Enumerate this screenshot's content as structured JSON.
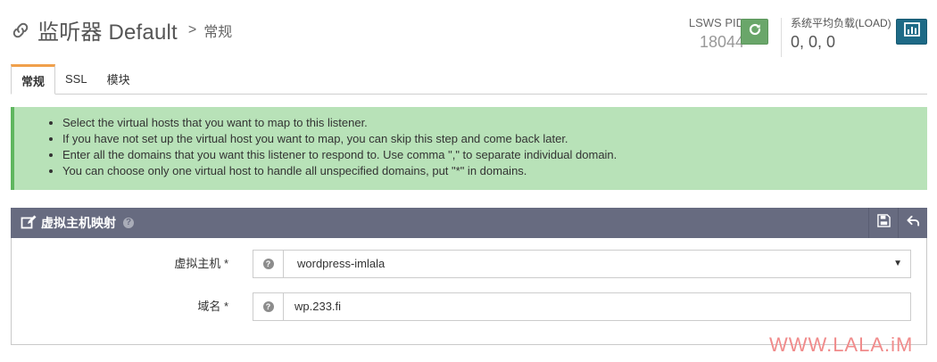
{
  "header": {
    "title": "监听器 Default",
    "breadcrumb_separator": ">",
    "breadcrumb_current": "常规",
    "link_icon": "link-icon"
  },
  "status": {
    "pid_label": "LSWS PID",
    "pid_value": "18044",
    "restart_icon": "refresh-icon",
    "load_label": "系统平均负载(LOAD)",
    "load_value": "0, 0, 0",
    "chart_icon": "bar-chart-icon"
  },
  "tabs": [
    {
      "label": "常规",
      "active": true
    },
    {
      "label": "SSL",
      "active": false
    },
    {
      "label": "模块",
      "active": false
    }
  ],
  "info": {
    "items": [
      "Select the virtual hosts that you want to map to this listener.",
      "If you have not set up the virtual host you want to map, you can skip this step and come back later.",
      "Enter all the domains that you want this listener to respond to. Use comma \",\" to separate individual domain.",
      "You can choose only one virtual host to handle all unspecified domains, put \"*\" in domains."
    ]
  },
  "panel": {
    "title": "虚拟主机映射",
    "edit_icon": "edit-icon",
    "help_icon": "question-circle-icon",
    "save_icon": "save-icon",
    "back_icon": "undo-icon"
  },
  "form": {
    "vhost_label": "虚拟主机 *",
    "vhost_value": "wordpress-imlala",
    "domain_label": "域名 *",
    "domain_value": "wp.233.fi"
  },
  "watermark": {
    "text": "WWW.LALA.iM"
  },
  "colors": {
    "accent_tab": "#f0a04b",
    "info_bg": "#b8e2b8",
    "info_border": "#5fb65f",
    "panel_header": "#676b80",
    "restart_button": "#6aa66a",
    "chart_button": "#1e6a86",
    "watermark": "#f08b8b"
  }
}
